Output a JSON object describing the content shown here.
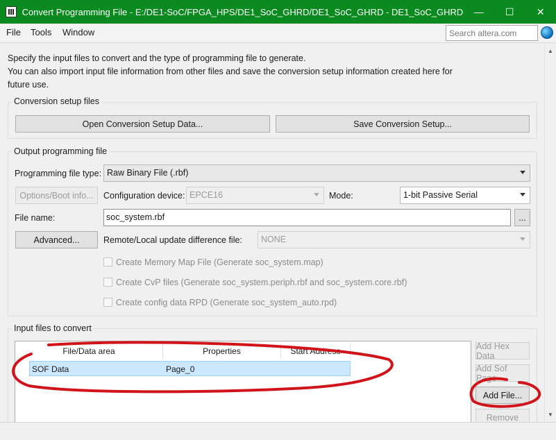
{
  "window": {
    "title": "Convert Programming File - E:/DE1-SoC/FPGA_HPS/DE1_SoC_GHRD/DE1_SoC_GHRD - DE1_SoC_GHRD",
    "minimize": "—",
    "maximize": "☐",
    "close": "✕"
  },
  "menu": {
    "file": "File",
    "tools": "Tools",
    "window": "Window"
  },
  "search": {
    "placeholder": "Search altera.com"
  },
  "intro": {
    "line1": "Specify the input files to convert and the type of programming file to generate.",
    "line2": "You can also import input file information from other files and save the conversion setup information created here for",
    "line3": "future use."
  },
  "conversion_setup": {
    "title": "Conversion setup files",
    "open_button": "Open Conversion Setup Data...",
    "save_button": "Save Conversion Setup..."
  },
  "output": {
    "title": "Output programming file",
    "file_type_label": "Programming file type:",
    "file_type_value": "Raw Binary File (.rbf)",
    "options_button": "Options/Boot info...",
    "config_device_label": "Configuration device:",
    "config_device_value": "EPCE16",
    "mode_label": "Mode:",
    "mode_value": "1-bit Passive Serial",
    "file_name_label": "File name:",
    "file_name_value": "soc_system.rbf",
    "browse_button": "...",
    "advanced_button": "Advanced...",
    "remote_label": "Remote/Local update difference file:",
    "remote_value": "NONE",
    "cb_memory_map": "Create Memory Map File (Generate soc_system.map)",
    "cb_cvp": "Create CvP files (Generate soc_system.periph.rbf and soc_system.core.rbf)",
    "cb_config_rpd": "Create config data RPD (Generate soc_system_auto.rpd)"
  },
  "input_files": {
    "title": "Input files to convert",
    "columns": [
      "File/Data area",
      "Properties",
      "Start Address"
    ],
    "rows": [
      {
        "area": "SOF Data",
        "properties": "Page_0",
        "start": ""
      }
    ],
    "add_hex_button": "Add Hex Data",
    "add_sof_button": "Add Sof Page",
    "add_file_button": "Add File...",
    "remove_button": "Remove"
  },
  "colors": {
    "titlebar": "#0a8a1f",
    "annotation": "#d0141a",
    "selection": "#cce8ff"
  },
  "icons": {
    "app": "programmer-icon",
    "globe": "globe-icon"
  }
}
